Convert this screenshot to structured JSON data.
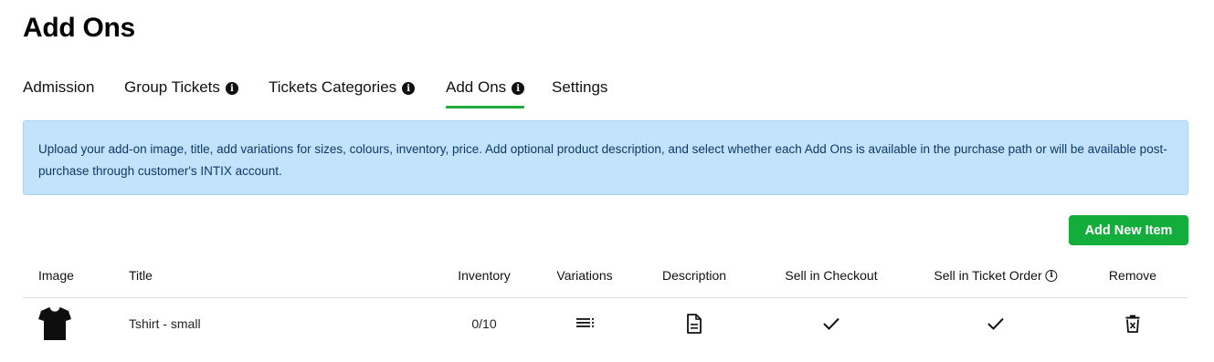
{
  "page": {
    "title": "Add Ons"
  },
  "tabs": [
    {
      "label": "Admission",
      "has_info": false,
      "active": false
    },
    {
      "label": "Group Tickets",
      "has_info": true,
      "active": false
    },
    {
      "label": "Tickets Categories",
      "has_info": true,
      "active": false
    },
    {
      "label": "Add Ons",
      "has_info": true,
      "active": true
    },
    {
      "label": "Settings",
      "has_info": false,
      "active": false
    }
  ],
  "banner": {
    "text": "Upload your add-on image, title, add variations for sizes, colours, inventory, price. Add optional product description, and select whether each Add Ons is available in the purchase path or will be available post-purchase through customer's INTIX account."
  },
  "actions": {
    "add_new_item_label": "Add New Item"
  },
  "table": {
    "columns": {
      "image": "Image",
      "title": "Title",
      "inventory": "Inventory",
      "variations": "Variations",
      "description": "Description",
      "sell_in_checkout": "Sell in Checkout",
      "sell_in_ticket_order": "Sell in Ticket Order",
      "remove": "Remove"
    },
    "rows": [
      {
        "image_icon": "tshirt-thumbnail",
        "title": "Tshirt - small",
        "inventory": "0/10",
        "variations_icon": "list-icon",
        "description_icon": "document-icon",
        "sell_in_checkout": true,
        "sell_in_ticket_order": true,
        "remove_icon": "trash-icon"
      }
    ]
  },
  "colors": {
    "accent": "#13ad3b",
    "tab_underline": "#22a93c",
    "banner_bg": "#c3e2fb",
    "banner_text": "#0d3a66"
  }
}
